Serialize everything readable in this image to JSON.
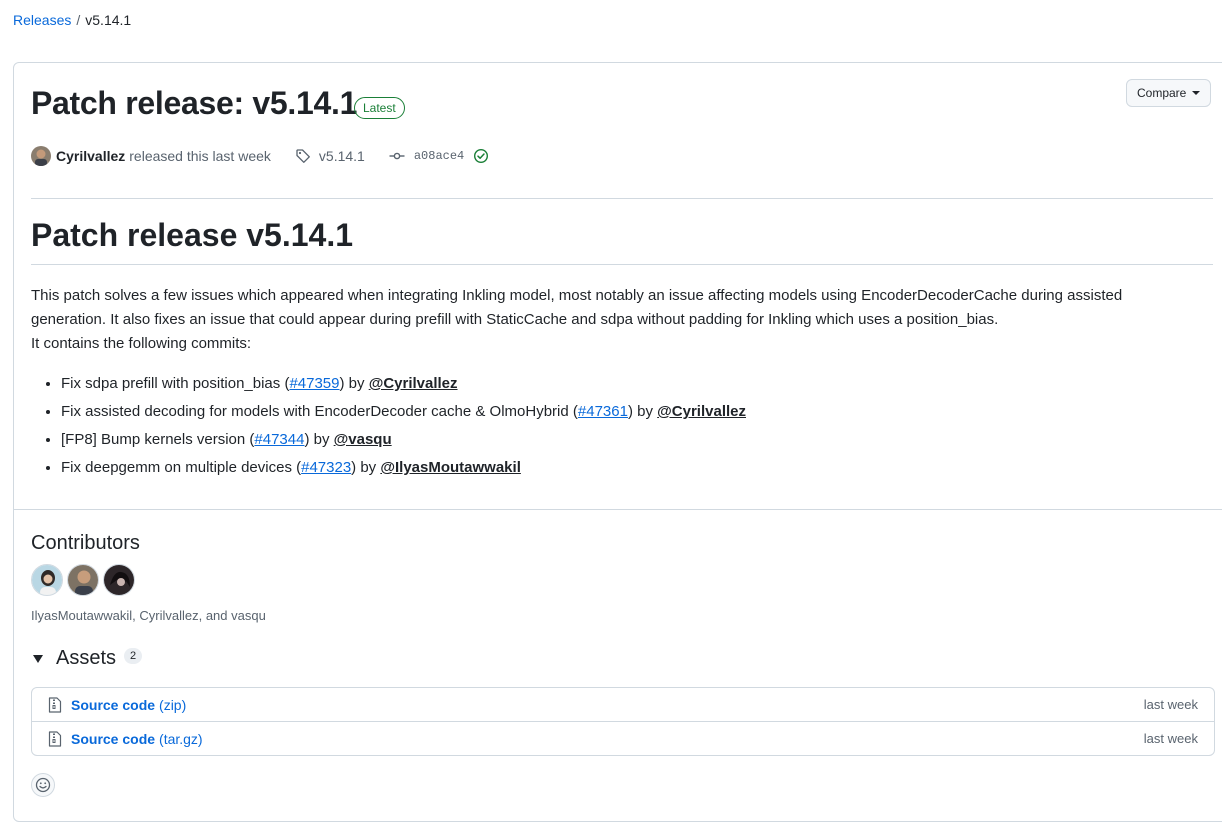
{
  "breadcrumb": {
    "releases_label": "Releases",
    "separator": "/",
    "current": "v5.14.1"
  },
  "release": {
    "title": "Patch release: v5.14.1",
    "badge": "Latest",
    "compare_label": "Compare",
    "author": "Cyrilvallez",
    "released_text": "released this last week",
    "tag": "v5.14.1",
    "commit": "a08ace4",
    "verified_icon": "check-circle-icon"
  },
  "notes": {
    "heading": "Patch release v5.14.1",
    "paragraph_line1": "This patch solves a few issues which appeared when integrating Inkling model, most notably an issue affecting models using EncoderDecoderCache during assisted",
    "paragraph_line2": "generation. It also fixes an issue that could appear during prefill with StaticCache and sdpa without padding for Inkling which uses a position_bias.",
    "paragraph_line3": "It contains the following commits:",
    "commits": [
      {
        "text": "Fix sdpa prefill with position_bias (",
        "pr": "#47359",
        "by": ") by ",
        "user": "@Cyrilvallez"
      },
      {
        "text": "Fix assisted decoding for models with EncoderDecoder cache & OlmoHybrid (",
        "pr": "#47361",
        "by": ") by ",
        "user": "@Cyrilvallez"
      },
      {
        "text": "[FP8] Bump kernels version (",
        "pr": "#47344",
        "by": ") by ",
        "user": "@vasqu"
      },
      {
        "text": "Fix deepgemm on multiple devices (",
        "pr": "#47323",
        "by": ") by ",
        "user": "@IlyasMoutawwakil"
      }
    ]
  },
  "contributors": {
    "title": "Contributors",
    "names": "IlyasMoutawwakil, Cyrilvallez, and vasqu"
  },
  "assets": {
    "title": "Assets",
    "count": "2",
    "items": [
      {
        "name": "Source code",
        "ext": "(zip)",
        "time": "last week"
      },
      {
        "name": "Source code",
        "ext": "(tar.gz)",
        "time": "last week"
      }
    ]
  },
  "colors": {
    "link": "#0969da",
    "success": "#1a7f37",
    "border": "#d1d9e0",
    "muted": "#59636e"
  }
}
